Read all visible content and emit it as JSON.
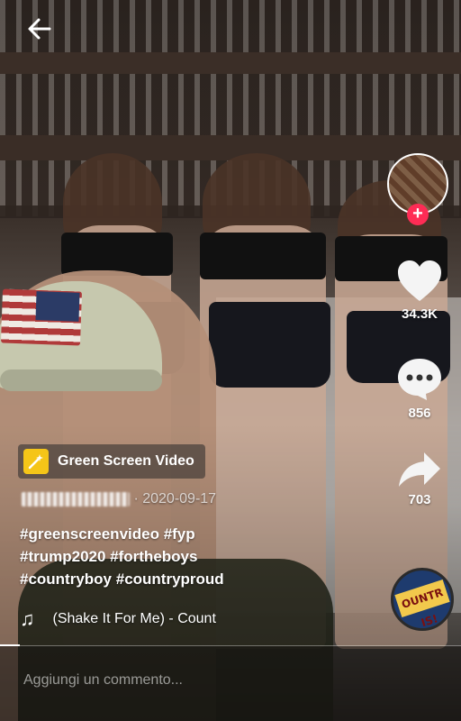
{
  "effect": {
    "label": "Green Screen Video",
    "icon": "magic-wand-icon"
  },
  "post": {
    "date": "2020-09-17",
    "date_separator": "·",
    "hashtags_line1": "#greenscreenvideo #fyp",
    "hashtags_line2": "#trump2020 #fortheboys",
    "hashtags_line3": "#countryboy #countryproud"
  },
  "actions": {
    "like_count": "34.3K",
    "comment_count": "856",
    "share_count": "703"
  },
  "music": {
    "title": "(Shake It For Me) - Count",
    "icon": "music-note-icon"
  },
  "sound_disc": {
    "label": "OUNTR IS!"
  },
  "comment_box": {
    "placeholder": "Aggiungi un commento..."
  },
  "colors": {
    "accent": "#fe2c55",
    "effect_badge": "#f5c518"
  }
}
